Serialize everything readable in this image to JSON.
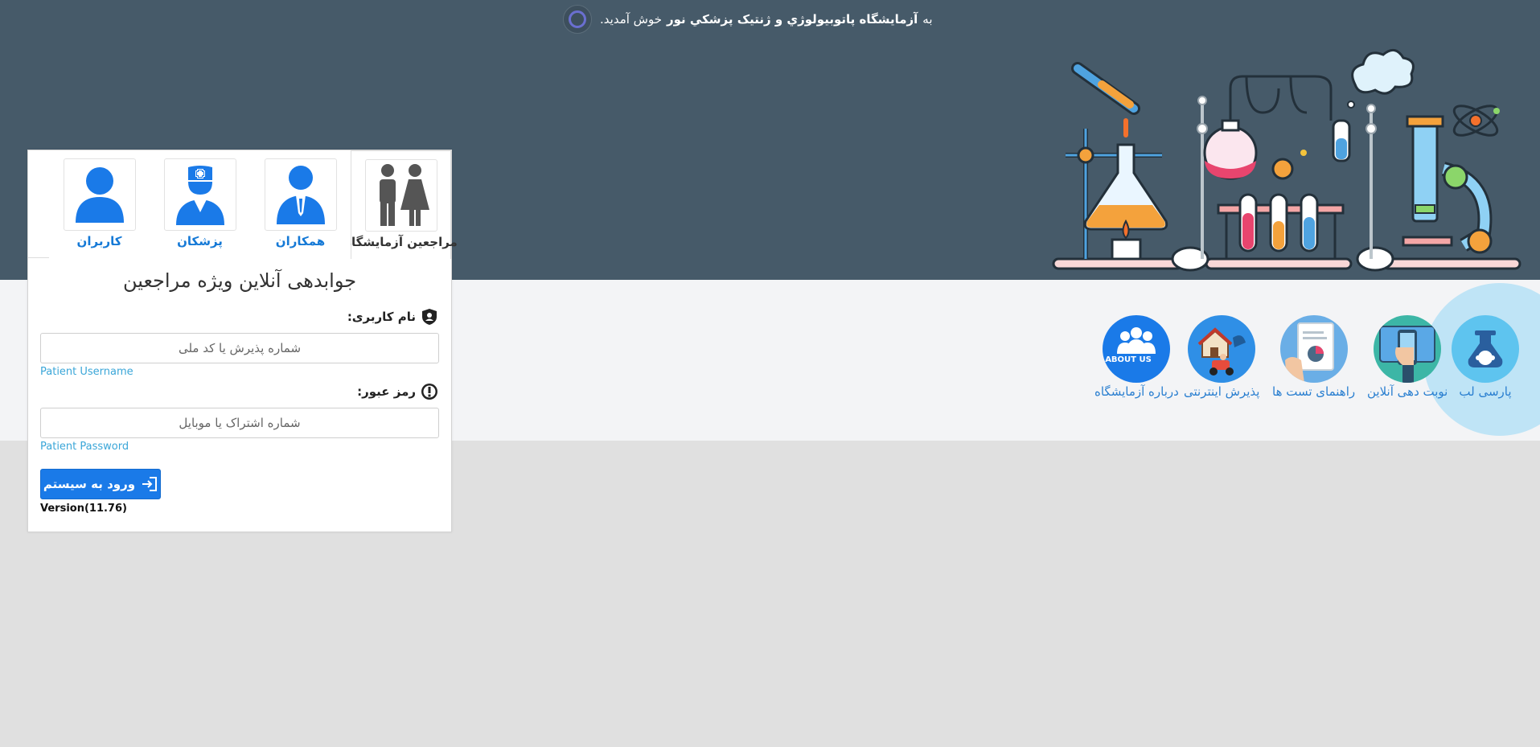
{
  "header": {
    "welcome_prefix": "به",
    "lab_name": "آزمایشگاه پاتوبیولوژي و ژنتیک پزشکي نور",
    "welcome_suffix": "خوش آمدید."
  },
  "login_panel": {
    "tabs": [
      {
        "label": "مراجعین آزمایشگاه",
        "icon": "patients-icon",
        "active": true
      },
      {
        "label": "همکاران",
        "icon": "colleague-icon",
        "active": false
      },
      {
        "label": "پزشکان",
        "icon": "doctor-icon",
        "active": false
      },
      {
        "label": "کاربران",
        "icon": "user-icon",
        "active": false
      }
    ],
    "title": "جوابدهی آنلاین ویژه مراجعین",
    "username_label": "نام کاربری:",
    "username_placeholder": "شماره پذیرش یا کد ملی",
    "username_hint": "Patient Username",
    "password_label": "رمز عبور:",
    "password_placeholder": "شماره اشتراک یا موبایل",
    "password_hint": "Patient Password",
    "login_button": "ورود به سیستم",
    "version": "Version(11.76)"
  },
  "services": [
    {
      "label": "پارسی لب",
      "icon": "parsilab-icon"
    },
    {
      "label": "نوبت دهی آنلاین",
      "icon": "online-appointment-icon"
    },
    {
      "label": "راهنمای تست ها",
      "icon": "test-guide-icon"
    },
    {
      "label": "پذیرش اینترنتی",
      "icon": "internet-admission-icon"
    },
    {
      "label": "درباره آزمایشگاه",
      "icon": "about-us-icon",
      "badge_text": "ABOUT US"
    }
  ],
  "colors": {
    "hero_bg": "#465a69",
    "band_bg": "#f3f4f6",
    "page_bg": "#e0e0e0",
    "accent_blue": "#1a7ae8",
    "link_blue": "#2a7fd0"
  }
}
